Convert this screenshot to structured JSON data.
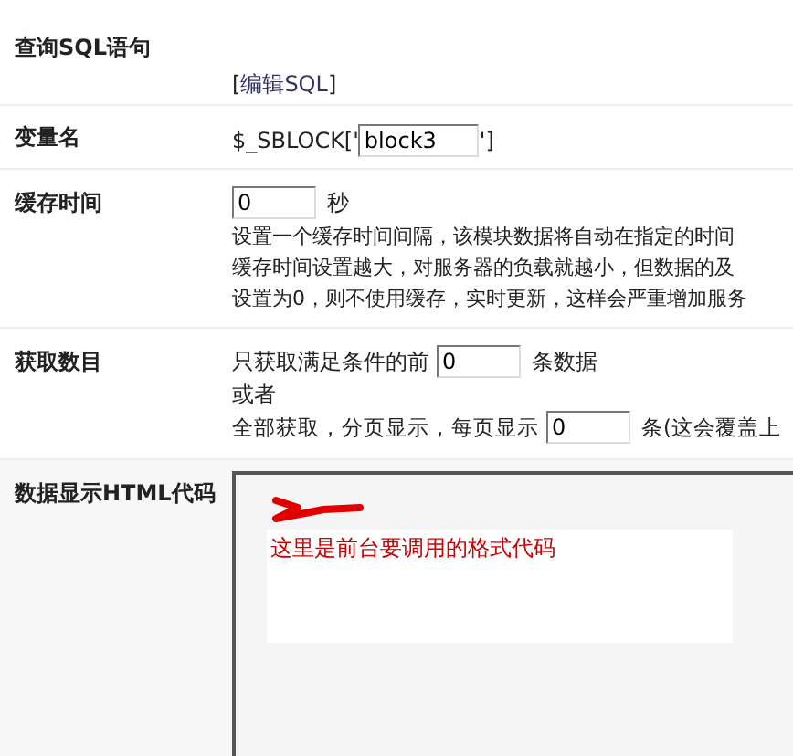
{
  "rows": [
    {
      "kind": "link",
      "label": "查询SQL语句",
      "link": "编辑SQL",
      "bracket_open": "[",
      "bracket_close": "]"
    },
    {
      "kind": "variable",
      "label": "变量名",
      "prefix": "$_SBLOCK['",
      "value": "block3",
      "suffix": "']"
    },
    {
      "kind": "cache",
      "label": "缓存时间",
      "value": "0",
      "unit": "秒",
      "notes": [
        "设置一个缓存时间间隔，该模块数据将自动在指定的时间",
        "缓存时间设置越大，对服务器的负载就越小，但数据的及",
        "设置为0，则不使用缓存，实时更新，这样会严重增加服务"
      ]
    },
    {
      "kind": "count",
      "label": "获取数目",
      "before": "只获取满足条件的前",
      "value": "0",
      "after": "条数据",
      "or": "或者",
      "paged_before": "全部获取，分页显示，每页显示",
      "paged_value": "0",
      "paged_after": "条(这会覆盖上"
    },
    {
      "kind": "code",
      "label": "数据显示HTML代码",
      "annotation": "这里是前台要调用的格式代码"
    }
  ]
}
